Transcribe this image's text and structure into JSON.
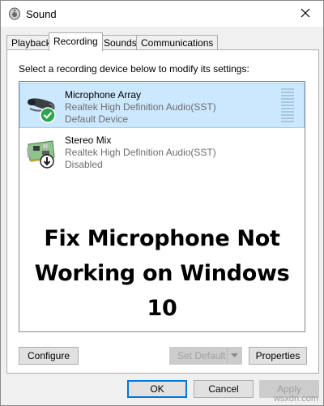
{
  "window": {
    "title": "Sound",
    "title_icon": "speaker-icon",
    "close_icon": "close-icon"
  },
  "tabs": [
    {
      "label": "Playback",
      "active": false
    },
    {
      "label": "Recording",
      "active": true
    },
    {
      "label": "Sounds",
      "active": false
    },
    {
      "label": "Communications",
      "active": false
    }
  ],
  "panel": {
    "instruction": "Select a recording device below to modify its settings:",
    "devices": [
      {
        "name": "Microphone Array",
        "driver": "Realtek High Definition Audio(SST)",
        "status": "Default Device",
        "icon": "microphone-icon",
        "badge": "default-check-icon",
        "selected": true
      },
      {
        "name": "Stereo Mix",
        "driver": "Realtek High Definition Audio(SST)",
        "status": "Disabled",
        "icon": "circuit-board-icon",
        "badge": "disabled-arrow-icon",
        "selected": false
      }
    ],
    "overlay_lines": [
      "Fix Microphone Not",
      "Working on Windows 10"
    ],
    "configure_label": "Configure",
    "set_default_label": "Set Default",
    "properties_label": "Properties"
  },
  "footer": {
    "ok_label": "OK",
    "cancel_label": "Cancel",
    "apply_label": "Apply"
  },
  "watermark": "wsxdn.com",
  "colors": {
    "selection": "#cce8ff",
    "accent": "#0078d7",
    "check": "#2ea44f"
  }
}
